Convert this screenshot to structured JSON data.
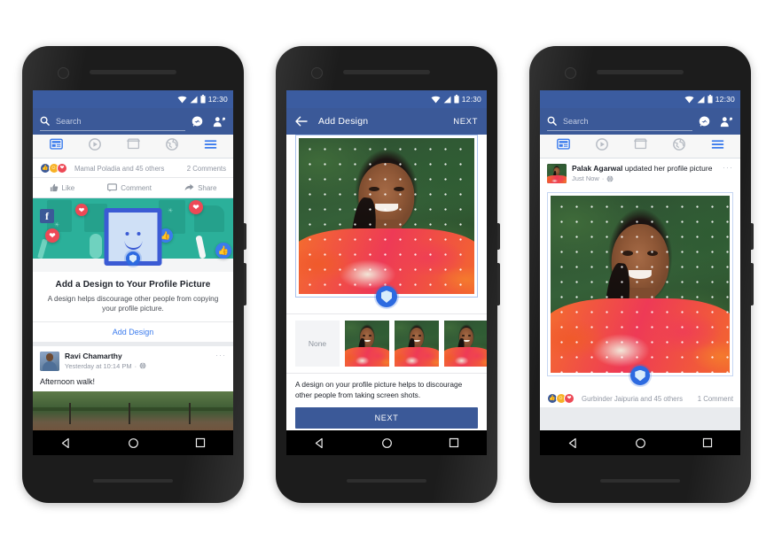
{
  "meta": {
    "status_time": "12:30",
    "accent_blue": "#3b5998",
    "link_blue": "#3b7bed",
    "badge_blue": "#2d6ae0"
  },
  "phone1": {
    "search": {
      "placeholder": "Search",
      "icon": "search-icon"
    },
    "header_icons": [
      "messenger-icon",
      "friend-requests-icon"
    ],
    "tabs": [
      {
        "name": "news-feed",
        "icon": "news-feed-icon",
        "active": true
      },
      {
        "name": "video",
        "icon": "video-play-icon",
        "active": false
      },
      {
        "name": "marketplace",
        "icon": "marketplace-store-icon",
        "active": false
      },
      {
        "name": "notifications",
        "icon": "globe-notifications-icon",
        "active": false
      },
      {
        "name": "menu",
        "icon": "hamburger-menu-icon",
        "active": false
      }
    ],
    "reactions_post": {
      "reactions": [
        "like",
        "haha",
        "love"
      ],
      "names": "Mamal Poladia and 45 others",
      "comments": "2 Comments"
    },
    "actions": [
      {
        "label": "Like",
        "icon": "thumbs-up-icon"
      },
      {
        "label": "Comment",
        "icon": "comment-bubble-icon"
      },
      {
        "label": "Share",
        "icon": "share-arrow-icon"
      }
    ],
    "promo": {
      "title": "Add a Design to Your Profile Picture",
      "subtitle": "A design helps discourage other people from copying your profile picture.",
      "cta": "Add Design"
    },
    "post": {
      "author": "Ravi Chamarthy",
      "time": "Yesterday at 10:14 PM",
      "privacy_icon": "globe-icon",
      "text": "Afternoon walk!",
      "menu_icon": "more-options-icon"
    }
  },
  "phone2": {
    "nav": {
      "back_icon": "back-arrow-icon",
      "title": "Add Design",
      "next": "NEXT"
    },
    "badge_icon": "guard-shield-badge-icon",
    "thumbnails": [
      {
        "label": "None",
        "type": "none",
        "selected": false
      },
      {
        "label": "",
        "type": "design",
        "selected": true
      },
      {
        "label": "",
        "type": "design",
        "selected": false
      },
      {
        "label": "",
        "type": "design",
        "selected": false
      }
    ],
    "description": "A design on your profile picture helps to discourage other people from taking screen shots.",
    "next_button": "NEXT"
  },
  "phone3": {
    "search": {
      "placeholder": "Search",
      "icon": "search-icon"
    },
    "tabs": [
      {
        "name": "news-feed",
        "icon": "news-feed-icon",
        "active": true
      },
      {
        "name": "video",
        "icon": "video-play-icon",
        "active": false
      },
      {
        "name": "marketplace",
        "icon": "marketplace-store-icon",
        "active": false
      },
      {
        "name": "notifications",
        "icon": "globe-notifications-icon",
        "active": false
      },
      {
        "name": "menu",
        "icon": "hamburger-menu-icon",
        "active": false
      }
    ],
    "post": {
      "author": "Palak Agarwal",
      "action": " updated her profile picture",
      "time": "Just Now",
      "privacy_icon": "globe-icon",
      "menu_icon": "more-options-icon"
    },
    "badge_icon": "guard-shield-badge-icon",
    "reactions_post": {
      "reactions": [
        "like",
        "haha",
        "love"
      ],
      "names": "Gurbinder Jaipuria and 45 others",
      "comments": "1 Comment"
    }
  },
  "android_nav": {
    "back": "back-triangle-icon",
    "home": "home-circle-icon",
    "recents": "recents-square-icon"
  }
}
